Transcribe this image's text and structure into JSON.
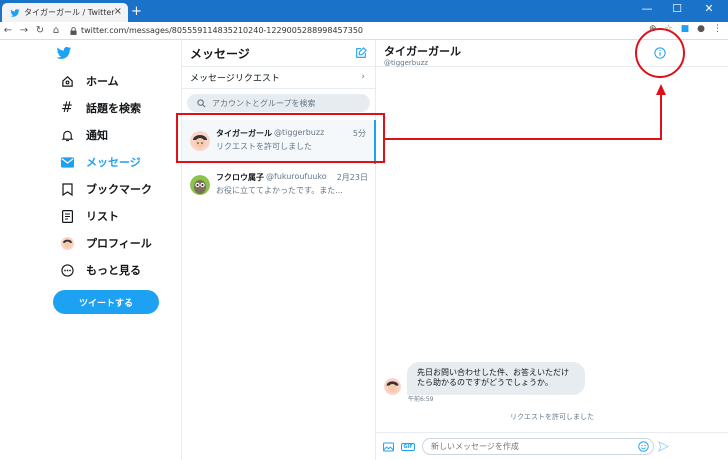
{
  "browser": {
    "tab_title": "タイガーガール / Twitter",
    "tab_close": "×",
    "new_tab": "+",
    "url": "twitter.com/messages/805559114835210240-1229005288998457350",
    "window_controls": [
      "—",
      "☐",
      "✕"
    ]
  },
  "nav": {
    "items": [
      {
        "label": "ホーム",
        "icon": "home-icon"
      },
      {
        "label": "話題を検索",
        "icon": "hashtag-icon"
      },
      {
        "label": "通知",
        "icon": "bell-icon"
      },
      {
        "label": "メッセージ",
        "icon": "mail-icon",
        "active": true
      },
      {
        "label": "ブックマーク",
        "icon": "bookmark-icon"
      },
      {
        "label": "リスト",
        "icon": "list-icon"
      },
      {
        "label": "プロフィール",
        "icon": "profile-avatar"
      },
      {
        "label": "もっと見る",
        "icon": "more-icon"
      }
    ],
    "tweet_button": "ツイートする"
  },
  "messages": {
    "title": "メッセージ",
    "request_row": "メッセージリクエスト",
    "search_placeholder": "アカウントとグループを検索",
    "conversations": [
      {
        "name": "タイガーガール",
        "handle": "@tiggerbuzz",
        "time": "5分",
        "preview": "リクエストを許可しました",
        "selected": true
      },
      {
        "name": "フクロウ属子",
        "handle": "@fukuroufuuko",
        "time": "2月23日",
        "preview": "お役に立ててよかったです。また..."
      }
    ]
  },
  "chat": {
    "title": "タイガーガール",
    "handle": "@tiggerbuzz",
    "message_text": "先日お問い合わせした件、お答えいただけたら助かるのですがどうでしょうか。",
    "message_time": "午前6:59",
    "system_message": "リクエストを許可しました",
    "input_placeholder": "新しいメッセージを作成",
    "gif_label": "GIF"
  },
  "colors": {
    "accent": "#1da1f2",
    "annotation": "#e0101a",
    "browser_bar": "#1a73c8"
  }
}
